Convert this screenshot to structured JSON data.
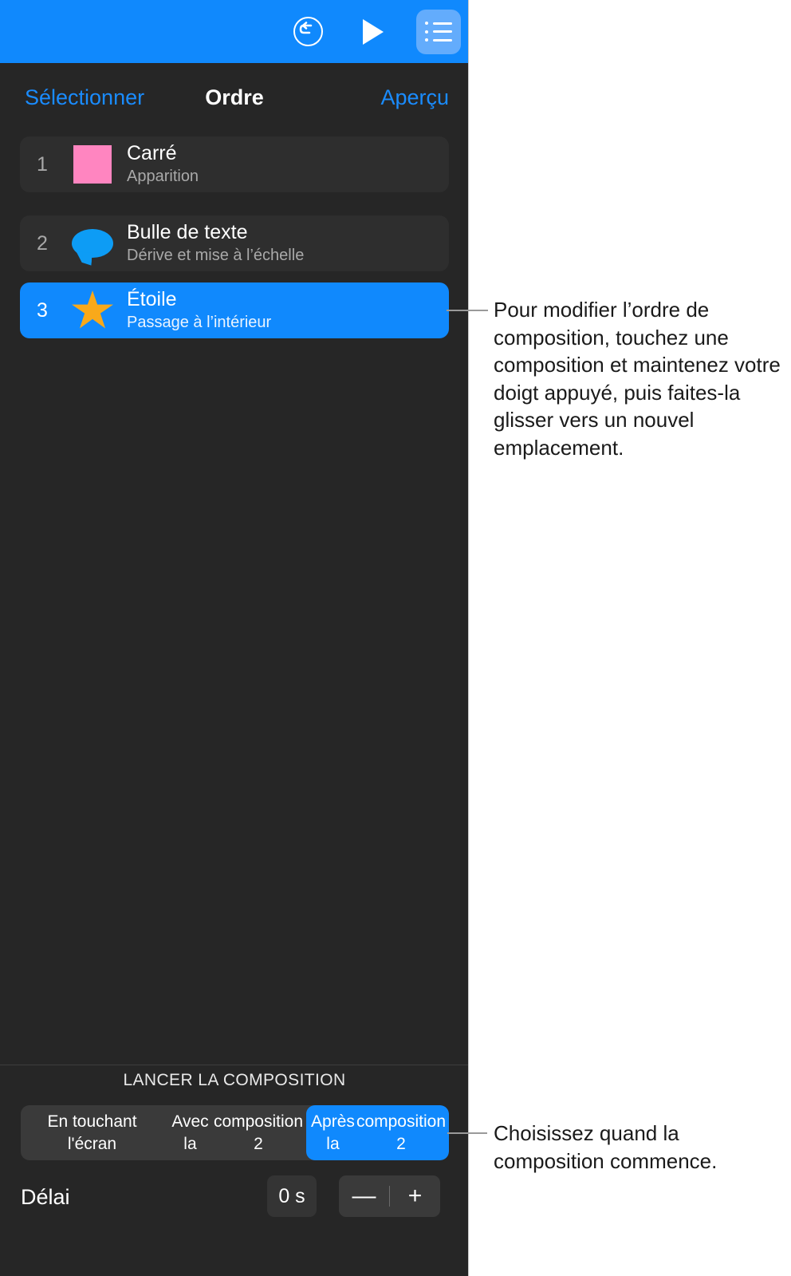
{
  "toolbar": {
    "icons": [
      {
        "name": "undo-icon",
        "label": "Annuler"
      },
      {
        "name": "play-icon",
        "label": "Lire"
      },
      {
        "name": "list-icon",
        "label": "Liste des compositions"
      }
    ]
  },
  "navbar": {
    "left_button": "Sélectionner",
    "title": "Ordre",
    "right_button": "Aperçu"
  },
  "build_list": [
    {
      "number": "1",
      "title": "Carré",
      "subtitle": "Apparition",
      "thumb": "pink-square-icon",
      "selected": false
    },
    {
      "number": "2",
      "title": "Bulle de texte",
      "subtitle": "Dérive et mise à l’échelle",
      "thumb": "speech-bubble-icon",
      "selected": false
    },
    {
      "number": "3",
      "title": "Étoile",
      "subtitle": "Passage à l’intérieur",
      "thumb": "star-icon",
      "selected": true
    }
  ],
  "start_build": {
    "heading": "LANCER LA COMPOSITION",
    "options": [
      {
        "label": "En touchant l'écran",
        "selected": false
      },
      {
        "label": "Avec la\ncomposition 2",
        "line1": "Avec la",
        "line2": "composition 2",
        "selected": false
      },
      {
        "label": "Après la\ncomposition 2",
        "line1": "Après la",
        "line2": "composition 2",
        "selected": true
      }
    ]
  },
  "delay": {
    "label": "Délai",
    "value": "0 s",
    "decrement": "—",
    "increment": "+"
  },
  "callouts": [
    {
      "text": "Pour modifier l’ordre de composition, touchez une composition et maintenez votre doigt appuyé, puis faites-la glisser vers un nouvel emplacement."
    },
    {
      "text": "Choisissez quand la composition commence."
    }
  ],
  "colors": {
    "accent_blue": "#1089FD",
    "toolbar_active": "#63ACFC",
    "panel_bg": "#262626",
    "row_bg": "#2E2E2E",
    "pink_square": "#FF85C0",
    "bubble_blue": "#0D9CF5",
    "star_orange": "#F9A91A",
    "link_blue": "#1A8CFF"
  }
}
